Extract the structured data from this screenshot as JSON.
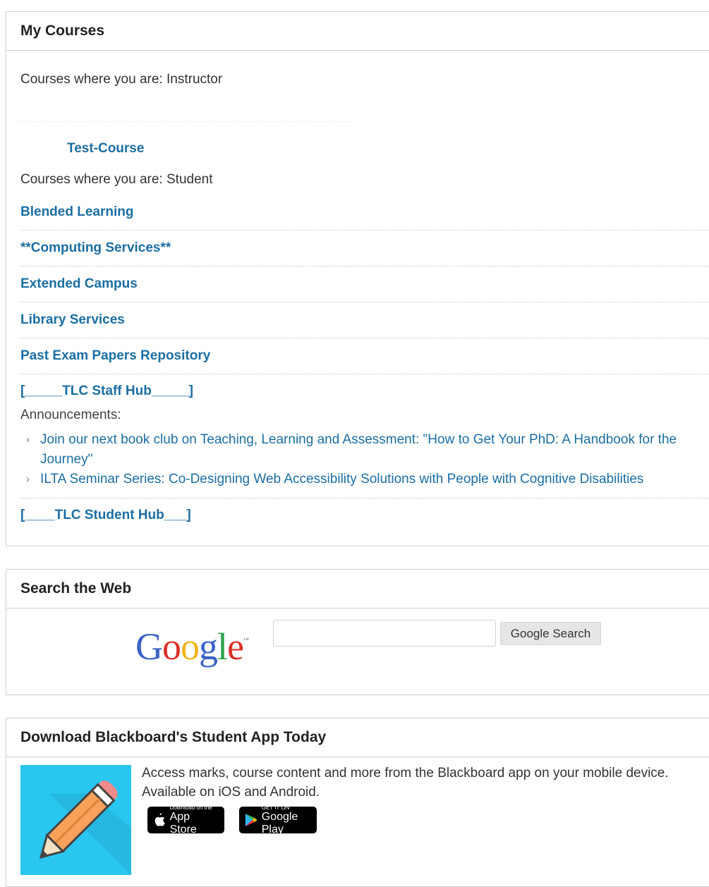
{
  "my_courses": {
    "title": "My Courses",
    "instructor_heading": "Courses where you are: Instructor",
    "instructor_courses": [
      "Test-Course"
    ],
    "student_heading": "Courses where you are: Student",
    "student_courses": [
      "Blended Learning",
      "**Computing Services**",
      "Extended Campus",
      "Library Services",
      "Past Exam Papers Repository",
      "[_____TLC Staff Hub_____]"
    ],
    "announcements_label": "Announcements:",
    "announcements": [
      "Join our next book club on Teaching, Learning and Assessment: \"How to Get Your PhD: A Handbook for the Journey\"",
      "ILTA Seminar Series: Co-Designing Web Accessibility Solutions with People with Cognitive Disabilities"
    ],
    "last_course": "[____TLC Student Hub___]"
  },
  "search": {
    "title": "Search the Web",
    "logo_text": "Google",
    "input_value": "",
    "button_label": "Google Search"
  },
  "app_module": {
    "title": "Download Blackboard's Student App Today",
    "description": "Access marks, course content and more from the Blackboard app on your mobile device. Available on iOS and Android.",
    "app_store_small": "Download on the",
    "app_store_big": "App Store",
    "google_play_small": "GET IT ON",
    "google_play_big": "Google Play"
  },
  "colors": {
    "link": "#1b6ea3",
    "app_image_bg": "#29c6ef"
  }
}
